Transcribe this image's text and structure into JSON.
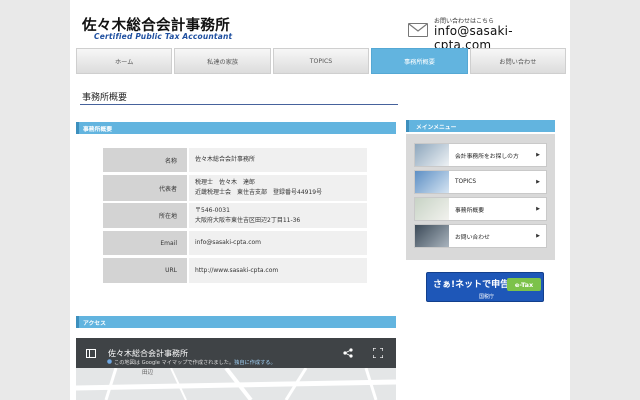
{
  "header": {
    "title": "佐々木総合会計事務所",
    "subtitle": "Certified Public Tax Accountant",
    "contact_label": "お問い合わせはこちら",
    "contact_email": "info@sasaki-cpta.com"
  },
  "nav": {
    "items": [
      {
        "label": "ホーム"
      },
      {
        "label": "私達の家族"
      },
      {
        "label": "TOPICS"
      },
      {
        "label": "事務所概要"
      },
      {
        "label": "お問い合わせ"
      }
    ]
  },
  "main": {
    "page_title": "事務所概要",
    "section_overview": "事務所概要",
    "rows": [
      {
        "label": "名称",
        "line1": "佐々木総合会計事務所",
        "line2": ""
      },
      {
        "label": "代表者",
        "line1": "税理士　佐々木　達郎",
        "line2": "近畿税理士会　東住吉支部　登録番号44919号"
      },
      {
        "label": "所在地",
        "line1": "〒546-0031",
        "line2": "大阪府大阪市東住吉区田辺2丁目11-36"
      },
      {
        "label": "Email",
        "line1": "info@sasaki-cpta.com",
        "line2": ""
      },
      {
        "label": "URL",
        "line1": "http://www.sasaki-cpta.com",
        "line2": ""
      }
    ],
    "section_access": "アクセス",
    "map_title": "佐々木総合会計事務所",
    "map_sub": "この地図は Google マイマップで作成されました。",
    "map_sub_link": "独自に作成する。",
    "map_label": "田辺"
  },
  "sidebar": {
    "menu_title": "メインメニュー",
    "items": [
      {
        "label": "会計事務所をお探しの方"
      },
      {
        "label": "TOPICS"
      },
      {
        "label": "事務所概要"
      },
      {
        "label": "お問い合わせ"
      }
    ],
    "banner_main": "さぁ!ネットで申告",
    "banner_badge": "e-Tax",
    "banner_sub": "国税庁"
  },
  "colors": {
    "accent": "#62b4df",
    "title_line": "#46629c"
  }
}
